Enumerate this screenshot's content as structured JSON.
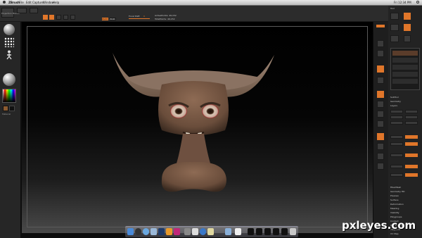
{
  "menubar": {
    "app": "ZBrush",
    "items": [
      "File",
      "Edit",
      "Capture",
      "Window",
      "Help"
    ],
    "window_title": "ZBrush",
    "clock": "Fri 12:34 PM"
  },
  "topbar": {
    "tool_label": "Projection Master",
    "focal_label": "Focal Shift",
    "draw_label": "Draw Size",
    "zadd_label": "Zadd",
    "zsub_label": "Zsub",
    "focal_value": "0",
    "draw_value": "64",
    "active_points": "ActivePoints: 49,152",
    "total_points": "TotalPoints: 49,152"
  },
  "right_panel": {
    "tool_header": "Tool",
    "subtools": [
      "SubTool",
      "Geometry",
      "Layers",
      "FiberMesh",
      "Geometry HD",
      "Preview",
      "Surface",
      "Deformation",
      "Masking",
      "Visibility",
      "Polygroups",
      "Contact",
      "Morph Target",
      "Polypaint",
      "UV Map"
    ],
    "list_bottom": [
      "Lasso",
      "Smooth",
      "Geometry",
      "Layers"
    ]
  },
  "left_panel": {
    "material_label": "Material"
  },
  "dock": {
    "icons": [
      "finder",
      "dashboard",
      "safari",
      "mail",
      "photoshop",
      "illustrator",
      "indesign",
      "zbrush",
      "preview",
      "itunes",
      "textedit",
      "folder",
      "documents",
      "trash"
    ]
  },
  "watermark": "pxleyes.com",
  "colors": {
    "accent": "#e0762a",
    "canvas_top": "#000000",
    "canvas_bottom": "#4a4a4a",
    "skin": "#7a5a45"
  }
}
